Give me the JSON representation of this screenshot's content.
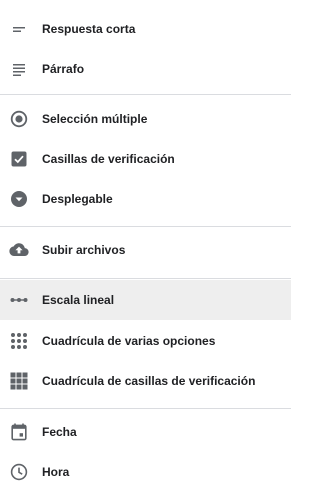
{
  "menu": {
    "items": [
      {
        "label": "Respuesta corta",
        "icon": "short-text-icon"
      },
      {
        "label": "Párrafo",
        "icon": "paragraph-icon"
      },
      {
        "label": "Selección múltiple",
        "icon": "radio-button-icon"
      },
      {
        "label": "Casillas de verificación",
        "icon": "checkbox-icon"
      },
      {
        "label": "Desplegable",
        "icon": "dropdown-icon"
      },
      {
        "label": "Subir archivos",
        "icon": "cloud-upload-icon"
      },
      {
        "label": "Escala lineal",
        "icon": "linear-scale-icon"
      },
      {
        "label": "Cuadrícula de varias opciones",
        "icon": "grid-dots-icon"
      },
      {
        "label": "Cuadrícula de casillas de verificación",
        "icon": "grid-squares-icon"
      },
      {
        "label": "Fecha",
        "icon": "calendar-icon"
      },
      {
        "label": "Hora",
        "icon": "clock-icon"
      }
    ],
    "highlighted_item": "Escala lineal"
  },
  "colors": {
    "icon": "#5f6368",
    "text": "#202124",
    "divider": "#dadce0",
    "highlight": "#eeeeee"
  }
}
